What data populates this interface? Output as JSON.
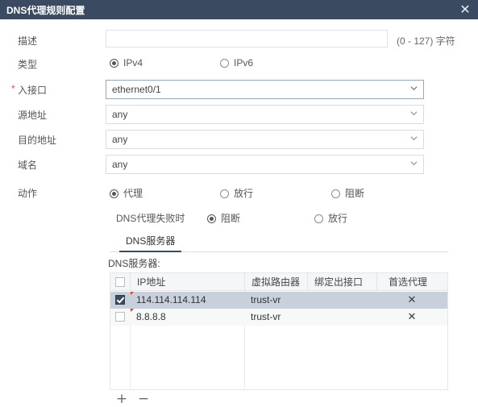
{
  "window": {
    "title": "DNS代理规则配置",
    "close_icon": "close-icon",
    "accent_color": "#3a4a61"
  },
  "form": {
    "description": {
      "label": "描述",
      "value": "",
      "placeholder": "",
      "hint": "(0 - 127) 字符"
    },
    "type": {
      "label": "类型",
      "options": [
        {
          "label": "IPv4",
          "checked": true
        },
        {
          "label": "IPv6",
          "checked": false
        }
      ]
    },
    "in_interface": {
      "label": "入接口",
      "required": true,
      "required_marker": "*",
      "value": "ethernet0/1",
      "focused": true
    },
    "src_address": {
      "label": "源地址",
      "value": "any"
    },
    "dst_address": {
      "label": "目的地址",
      "value": "any"
    },
    "domain": {
      "label": "域名",
      "value": "any"
    },
    "action": {
      "label": "动作",
      "options": [
        {
          "label": "代理",
          "checked": true
        },
        {
          "label": "放行",
          "checked": false
        },
        {
          "label": "阻断",
          "checked": false
        }
      ]
    },
    "on_proxy_fail": {
      "label": "DNS代理失败时",
      "options": [
        {
          "label": "阻断",
          "checked": true
        },
        {
          "label": "放行",
          "checked": false
        }
      ]
    }
  },
  "tabs": [
    {
      "label": "DNS服务器",
      "active": true
    }
  ],
  "dns_section": {
    "title": "DNS服务器:",
    "table": {
      "header_checkbox_checked": false,
      "columns": [
        "IP地址",
        "虚拟路由器",
        "绑定出接口",
        "首选代理"
      ],
      "rows": [
        {
          "selected": true,
          "ip": "114.114.114.114",
          "vrouter": "trust-vr",
          "bind_interface": "",
          "preferred_proxy": "✕"
        },
        {
          "selected": false,
          "ip": "8.8.8.8",
          "vrouter": "trust-vr",
          "bind_interface": "",
          "preferred_proxy": "✕"
        }
      ]
    },
    "add_button": "+",
    "remove_button": "−"
  }
}
